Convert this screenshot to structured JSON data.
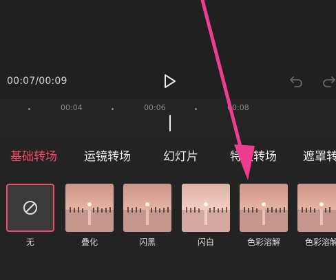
{
  "player": {
    "time_display": "00:07/00:09"
  },
  "timeline": {
    "ticks": [
      "00:04",
      "00:06",
      "00:08"
    ]
  },
  "tabs": [
    {
      "label": "基础转场",
      "active": true
    },
    {
      "label": "运镜转场",
      "active": false
    },
    {
      "label": "幻灯片",
      "active": false
    },
    {
      "label": "特效转场",
      "active": false
    },
    {
      "label": "遮罩转场",
      "active": false
    }
  ],
  "transitions": [
    {
      "label": "无",
      "icon": "none-icon",
      "selected": true
    },
    {
      "label": "叠化",
      "selected": false
    },
    {
      "label": "闪黑",
      "selected": false
    },
    {
      "label": "闪白",
      "selected": false
    },
    {
      "label": "色彩溶解",
      "selected": false
    },
    {
      "label": "色彩溶解",
      "selected": false
    }
  ],
  "colors": {
    "accent": "#f2496c",
    "annotation_arrow": "#ee3d8f"
  }
}
